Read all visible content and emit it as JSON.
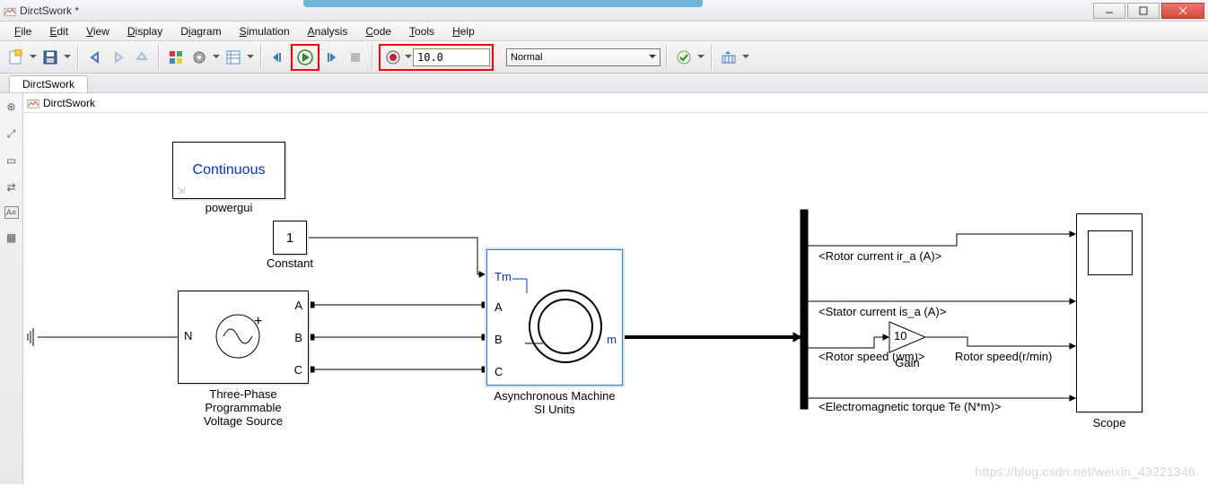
{
  "window": {
    "title": "DirctSwork *"
  },
  "menus": [
    "File",
    "Edit",
    "View",
    "Display",
    "Diagram",
    "Simulation",
    "Analysis",
    "Code",
    "Tools",
    "Help"
  ],
  "toolbar": {
    "stop_time": "10.0",
    "mode": "Normal"
  },
  "tab": {
    "label": "DirctSwork"
  },
  "breadcrumb": {
    "model": "DirctSwork"
  },
  "blocks": {
    "powergui": {
      "text": "Continuous",
      "label": "powergui"
    },
    "constant": {
      "value": "1",
      "label": "Constant"
    },
    "source": {
      "label": "Three-Phase\nProgrammable\nVoltage Source",
      "ports": [
        "A",
        "B",
        "C"
      ],
      "neutral": "N"
    },
    "machine": {
      "label": "Asynchronous Machine\nSI Units",
      "tm": "Tm",
      "m": "m",
      "ports": [
        "A",
        "B",
        "C"
      ]
    },
    "gain": {
      "value": "10",
      "label": "Gain"
    },
    "scope": {
      "label": "Scope"
    },
    "signals": {
      "sig1": "<Rotor current ir_a (A)>",
      "sig2": "<Stator current is_a (A)>",
      "sig3": "<Rotor speed (wm)>",
      "sig3_out": "Rotor speed(r/min)",
      "sig4": "<Electromagnetic torque Te (N*m)>"
    }
  },
  "watermark": "https://blog.csdn.net/weixin_43221346"
}
